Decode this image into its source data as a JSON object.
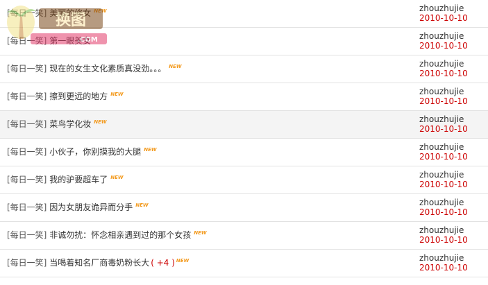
{
  "rows": [
    {
      "tag": "[每日一笑]",
      "title": "美丽的修女",
      "extra": "",
      "new": "NEW",
      "author": "zhouzhujie",
      "date": "2010-10-10"
    },
    {
      "tag": "[每日一笑]",
      "title": "第一眼美女",
      "extra": "",
      "new": "",
      "author": "zhouzhujie",
      "date": "2010-10-10"
    },
    {
      "tag": "[每日一笑]",
      "title": "现在的女生文化素质真没劲。。。",
      "extra": "",
      "new": "NEW",
      "author": "zhouzhujie",
      "date": "2010-10-10"
    },
    {
      "tag": "[每日一笑]",
      "title": "擦到更远的地方",
      "extra": "",
      "new": "NEW",
      "author": "zhouzhujie",
      "date": "2010-10-10"
    },
    {
      "tag": "[每日一笑]",
      "title": "菜鸟学化妆",
      "extra": "",
      "new": "NEW",
      "author": "zhouzhujie",
      "date": "2010-10-10"
    },
    {
      "tag": "[每日一笑]",
      "title": "小伙子，你别摸我的大腿",
      "extra": "",
      "new": "NEW",
      "author": "zhouzhujie",
      "date": "2010-10-10"
    },
    {
      "tag": "[每日一笑]",
      "title": "我的驴要超车了",
      "extra": "",
      "new": "NEW",
      "author": "zhouzhujie",
      "date": "2010-10-10"
    },
    {
      "tag": "[每日一笑]",
      "title": "因为女朋友诡异而分手",
      "extra": "",
      "new": "NEW",
      "author": "zhouzhujie",
      "date": "2010-10-10"
    },
    {
      "tag": "[每日一笑]",
      "title": "非诚勿扰：怀念相亲遇到过的那个女孩",
      "extra": "",
      "new": "NEW",
      "author": "zhouzhujie",
      "date": "2010-10-10"
    },
    {
      "tag": "[每日一笑]",
      "title": "当喝着知名厂商毒奶粉长大",
      "extra": "( +4 )",
      "new": "NEW",
      "author": "zhouzhujie",
      "date": "2010-10-10"
    }
  ],
  "watermark": {
    "text": "换图",
    "sub": "bb.com"
  },
  "colors": {
    "date": "#cc0000",
    "badge": "#f39a1e",
    "divider": "#e2e2e2",
    "highlight_bg": "#f4f4f4"
  }
}
